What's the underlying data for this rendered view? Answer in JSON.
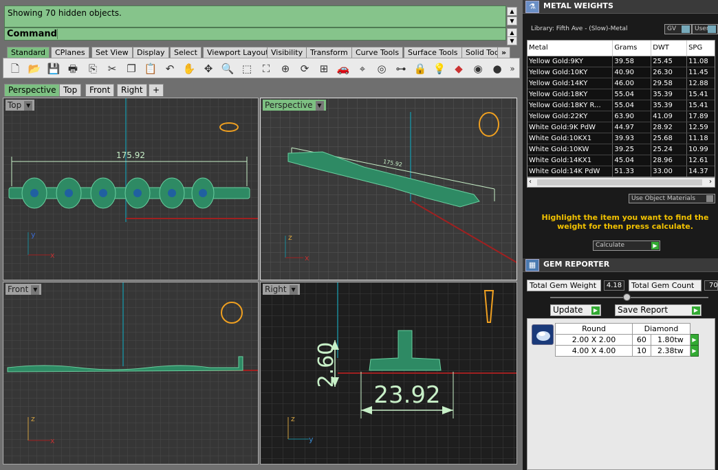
{
  "command": {
    "history": "Showing 70 hidden objects.",
    "label": "Command:",
    "value": ""
  },
  "toolbar_tabs": [
    "Standard",
    "CPlanes",
    "Set View",
    "Display",
    "Select",
    "Viewport Layout",
    "Visibility",
    "Transform",
    "Curve Tools",
    "Surface Tools",
    "Solid Tod"
  ],
  "toolbar_more": "»",
  "toolbar_icons": [
    "new-file-icon",
    "open-folder-icon",
    "save-icon",
    "print-icon",
    "import-icon",
    "cut-icon",
    "copy-icon",
    "paste-icon",
    "undo-icon",
    "pan-hand-icon",
    "rotate-view-icon",
    "zoom-icon",
    "zoom-window-icon",
    "zoom-extents-icon",
    "zoom-selected-icon",
    "rotate-icon",
    "four-viewports-icon",
    "car-icon",
    "properties-icon",
    "osnap-icon",
    "trim-icon",
    "lock-icon",
    "light-bulb-icon",
    "layer-icon",
    "color-wheel-icon",
    "render-sphere-icon"
  ],
  "viewport_tabs": [
    "Perspective",
    "Top",
    "Front",
    "Right",
    "+"
  ],
  "viewports": {
    "top": {
      "title": "Top",
      "dimension": "175.92",
      "axis_y": "y",
      "axis_x": "x"
    },
    "perspective": {
      "title": "Perspective",
      "dimension": "175.92",
      "axis_z": "z",
      "axis_x": "x"
    },
    "front": {
      "title": "Front",
      "axis_z": "z",
      "axis_x": "x"
    },
    "right": {
      "title": "Right",
      "dim_height": "2.60",
      "dim_width": "23.92",
      "axis_z": "z",
      "axis_y": "y"
    }
  },
  "metal_weights": {
    "title": "METAL WEIGHTS",
    "library": "Library: Fifth Ave - (Slow)-Metal",
    "gv": "GV",
    "user": "User",
    "columns": [
      "Metal",
      "Grams",
      "DWT",
      "SPG"
    ],
    "rows": [
      [
        "Yellow Gold:9KY",
        "39.58",
        "25.45",
        "11.08"
      ],
      [
        "Yellow Gold:10KY",
        "40.90",
        "26.30",
        "11.45"
      ],
      [
        "Yellow Gold:14KY",
        "46.00",
        "29.58",
        "12.88"
      ],
      [
        "Yellow Gold:18KY",
        "55.04",
        "35.39",
        "15.41"
      ],
      [
        "Yellow Gold:18KY R...",
        "55.04",
        "35.39",
        "15.41"
      ],
      [
        "Yellow Gold:22KY",
        "63.90",
        "41.09",
        "17.89"
      ],
      [
        "White Gold:9K PdW",
        "44.97",
        "28.92",
        "12.59"
      ],
      [
        "White Gold:10KX1",
        "39.93",
        "25.68",
        "11.18"
      ],
      [
        "White Gold:10KW",
        "39.25",
        "25.24",
        "10.99"
      ],
      [
        "White Gold:14KX1",
        "45.04",
        "28.96",
        "12.61"
      ],
      [
        "White Gold:14K PdW",
        "51.33",
        "33.00",
        "14.37"
      ]
    ],
    "use_object_materials": "Use Object Materials",
    "hint": "Highlight the item you want to find the weight for then press calculate.",
    "calculate": "Calculate"
  },
  "gem_reporter": {
    "title": "GEM REPORTER",
    "total_weight_label": "Total Gem Weight",
    "total_weight": "4.18",
    "total_count_label": "Total Gem Count",
    "total_count": "70",
    "update": "Update",
    "save_report": "Save Report",
    "header": [
      "Round",
      "Diamond"
    ],
    "rows": [
      [
        "2.00 X 2.00",
        "60",
        "1.80tw"
      ],
      [
        "4.00 X 4.00",
        "10",
        "2.38tw"
      ]
    ]
  }
}
